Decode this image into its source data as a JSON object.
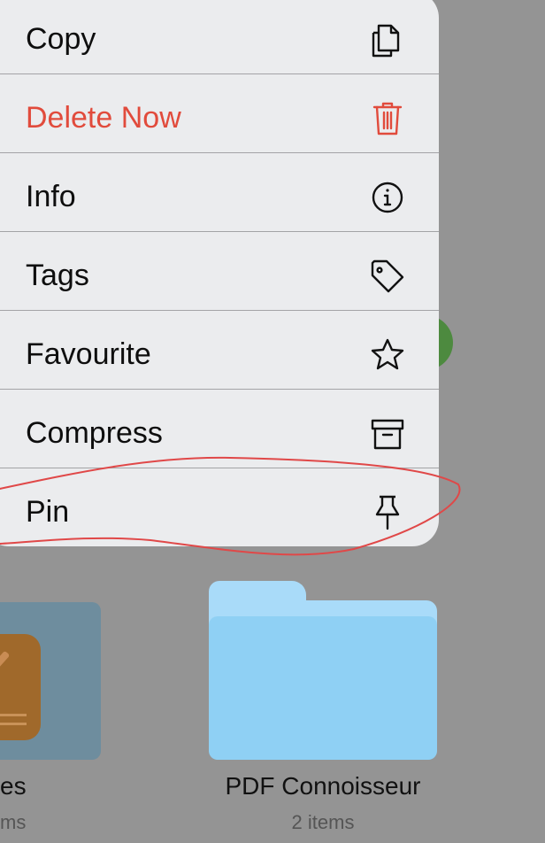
{
  "menu": {
    "items": [
      {
        "label": "Copy",
        "icon": "copy-icon"
      },
      {
        "label": "Delete Now",
        "icon": "trash-icon",
        "destructive": true
      },
      {
        "label": "Info",
        "icon": "info-icon"
      },
      {
        "label": "Tags",
        "icon": "tag-icon"
      },
      {
        "label": "Favourite",
        "icon": "star-icon"
      },
      {
        "label": "Compress",
        "icon": "archive-icon"
      },
      {
        "label": "Pin",
        "icon": "pin-icon"
      }
    ]
  },
  "files": [
    {
      "label": "es",
      "sub": "ms"
    },
    {
      "label": "PDF Connoisseur",
      "sub": "2 items"
    }
  ],
  "colors": {
    "destructive": "#e14b3c",
    "annotation": "#e04848",
    "folder": "#8fd0f4"
  }
}
